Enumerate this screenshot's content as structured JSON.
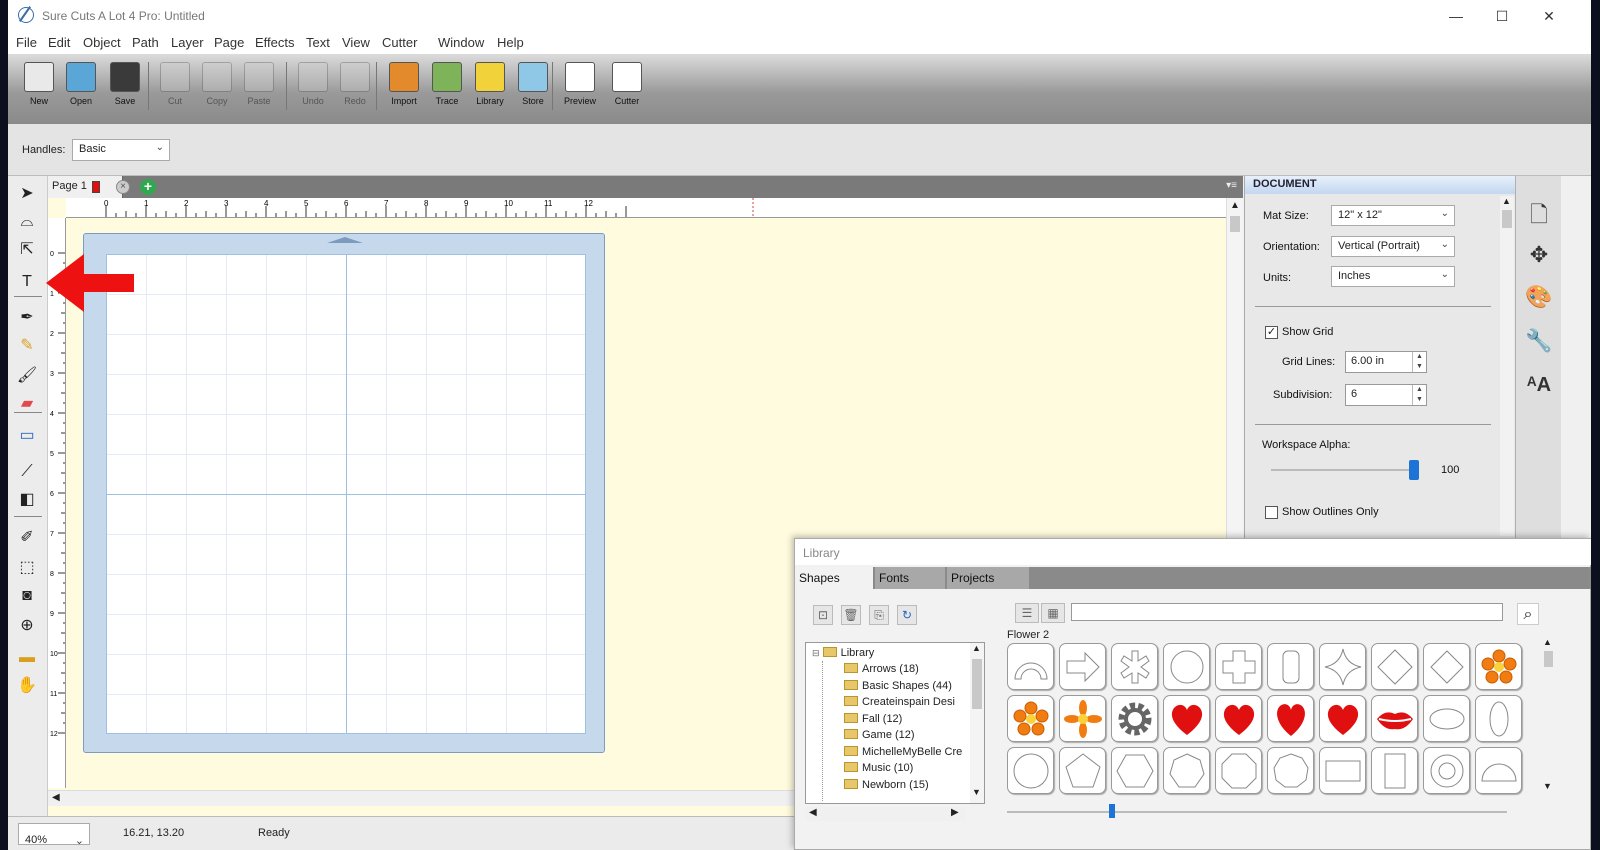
{
  "app": {
    "title": "Sure Cuts A Lot 4 Pro: Untitled"
  },
  "window_controls": {
    "minimize": "—",
    "maximize": "☐",
    "close": "✕"
  },
  "menu": [
    "File",
    "Edit",
    "Object",
    "Path",
    "Layer",
    "Page",
    "Effects",
    "Text",
    "View",
    "Cutter",
    "Window",
    "Help"
  ],
  "toolbar": [
    {
      "label": "New",
      "icon": "new-document-icon",
      "color": "#e9e9e9",
      "disabled": false
    },
    {
      "label": "Open",
      "icon": "open-icon",
      "color": "#5aa6d6",
      "disabled": false
    },
    {
      "label": "Save",
      "icon": "save-icon",
      "color": "#3a3a3a",
      "disabled": false
    },
    {
      "label": "Cut",
      "icon": "cut-icon",
      "color": "#cfcfcf",
      "disabled": true
    },
    {
      "label": "Copy",
      "icon": "copy-icon",
      "color": "#cfcfcf",
      "disabled": true
    },
    {
      "label": "Paste",
      "icon": "paste-icon",
      "color": "#cfcfcf",
      "disabled": true
    },
    {
      "label": "Undo",
      "icon": "undo-icon",
      "color": "#cfcfcf",
      "disabled": true
    },
    {
      "label": "Redo",
      "icon": "redo-icon",
      "color": "#cfcfcf",
      "disabled": true
    },
    {
      "label": "Import",
      "icon": "import-svg-icon",
      "color": "#e38a2c",
      "disabled": false
    },
    {
      "label": "Trace",
      "icon": "trace-icon",
      "color": "#7fb35a",
      "disabled": false
    },
    {
      "label": "Library",
      "icon": "library-star-icon",
      "color": "#f2d23a",
      "disabled": false
    },
    {
      "label": "Store",
      "icon": "store-cart-icon",
      "color": "#8fc7e6",
      "disabled": false
    },
    {
      "label": "Preview",
      "icon": "preview-magnifier-icon",
      "color": "#ffffff",
      "disabled": false
    },
    {
      "label": "Cutter",
      "icon": "cutter-pen-icon",
      "color": "#ffffff",
      "disabled": false
    }
  ],
  "options": {
    "handles_label": "Handles:",
    "handles_value": "Basic"
  },
  "tools": [
    "select-arrow-icon",
    "lasso-icon",
    "node-edit-icon",
    "text-tool-icon",
    "pen-tool-icon",
    "pencil-icon",
    "brush-icon",
    "eraser-icon",
    "rectangle-tool-icon",
    "eyedropper-icon",
    "fill-icon",
    "knife-icon",
    "transform-icon",
    "shadow-icon",
    "zoom-icon",
    "measure-icon",
    "hand-pan-icon"
  ],
  "page": {
    "tab_label": "Page 1",
    "page_color": "#e01010"
  },
  "ruler": {
    "top": [
      "0",
      "1",
      "2",
      "3",
      "4",
      "5",
      "6",
      "7",
      "8",
      "9",
      "10",
      "11",
      "12"
    ],
    "left": [
      "0",
      "1",
      "2",
      "3",
      "4",
      "5",
      "6",
      "7",
      "8",
      "9",
      "10",
      "11",
      "12"
    ]
  },
  "status": {
    "zoom": "40%",
    "coords": "16.21, 13.20",
    "state": "Ready"
  },
  "document": {
    "header": "DOCUMENT",
    "mat_size_label": "Mat Size:",
    "mat_size": "12\" x 12\"",
    "orientation_label": "Orientation:",
    "orientation": "Vertical (Portrait)",
    "units_label": "Units:",
    "units": "Inches",
    "show_grid_label": "Show Grid",
    "show_grid": true,
    "grid_lines_label": "Grid Lines:",
    "grid_lines": "6.00 in",
    "subdivision_label": "Subdivision:",
    "subdivision": "6",
    "alpha_label": "Workspace Alpha:",
    "alpha_value": "100",
    "alpha_level": 100,
    "outlines_label": "Show Outlines Only",
    "outlines": false
  },
  "side_panel_icons": [
    "document-page-icon",
    "move-arrows-icon",
    "palette-icon",
    "wrench-icon",
    "text-size-icon"
  ],
  "library": {
    "title": "Library",
    "tabs": [
      "Shapes",
      "Fonts",
      "Projects"
    ],
    "tree_root": "Library",
    "folders": [
      "Arrows (18)",
      "Basic Shapes (44)",
      "Createinspain Desi",
      "Fall (12)",
      "Game (12)",
      "MichelleMyBelle Cre",
      "Music (10)",
      "Newborn (15)"
    ],
    "selected_shape": "Flower 2",
    "search_placeholder": "",
    "shapes": [
      "arch",
      "arrow",
      "asterisk",
      "circle",
      "cross",
      "rounded-rect",
      "star4",
      "diamond",
      "diamond2",
      "flower-orange",
      "flower-orange",
      "flower-orange2",
      "gear",
      "heart",
      "heart",
      "heart2",
      "heart",
      "lips",
      "ellipse-h",
      "ellipse-v",
      "circle-thin",
      "pentagon",
      "hexagon",
      "heptagon",
      "octagon",
      "nonagon",
      "rect-h",
      "rect-v",
      "ring",
      "half-circle"
    ]
  }
}
